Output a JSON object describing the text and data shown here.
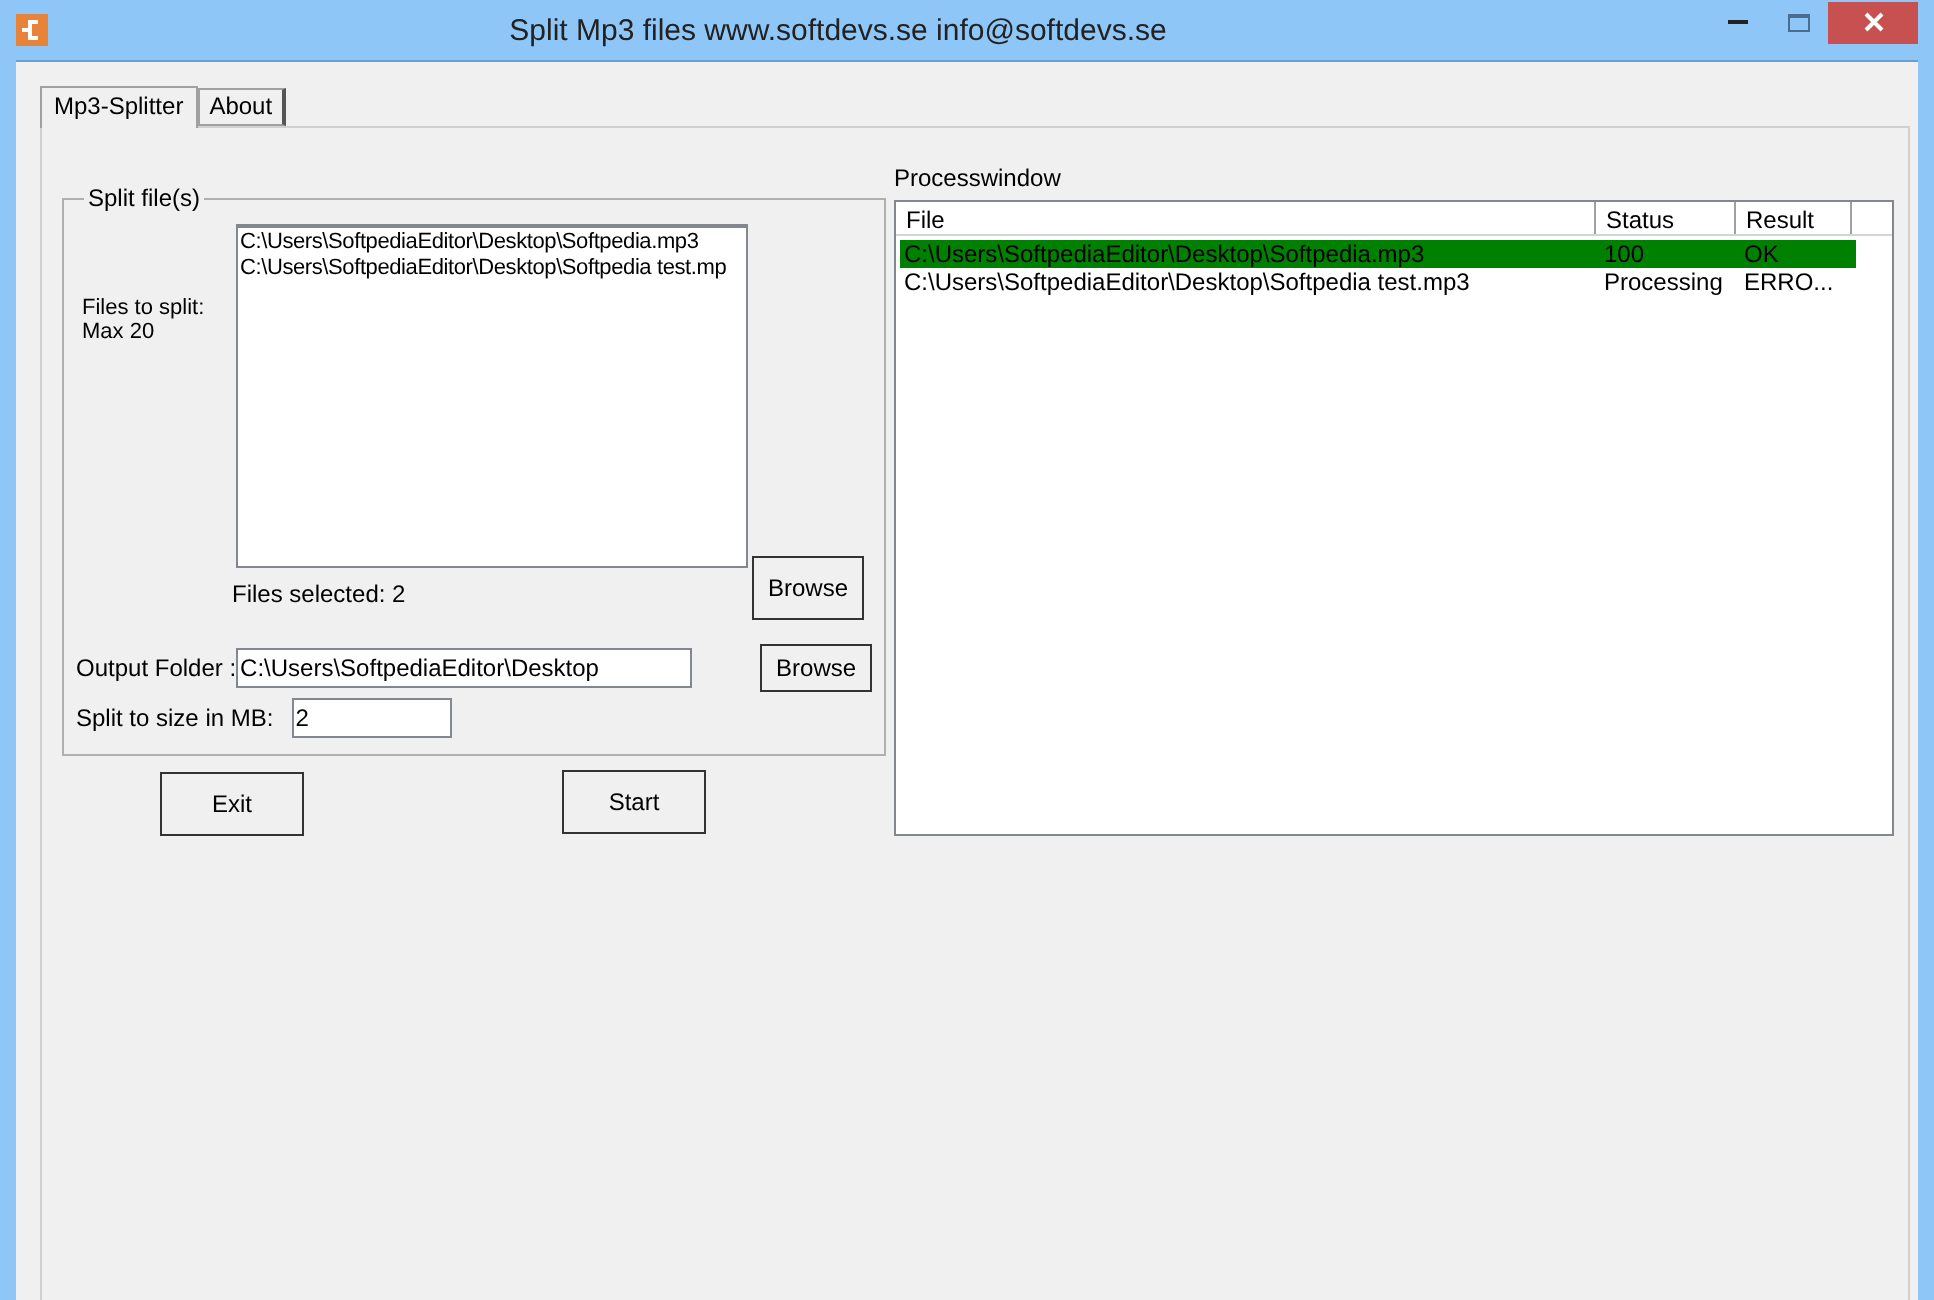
{
  "window": {
    "title": "Split Mp3 files www.softdevs.se info@softdevs.se"
  },
  "tabs": [
    {
      "label": "Mp3-Splitter",
      "selected": true
    },
    {
      "label": "About",
      "selected": false
    }
  ],
  "split_group": {
    "title": "Split file(s)",
    "files_label": "Files to split:",
    "files_hint": "Max 20",
    "files": [
      "C:\\Users\\SoftpediaEditor\\Desktop\\Softpedia.mp3",
      "C:\\Users\\SoftpediaEditor\\Desktop\\Softpedia test.mp"
    ],
    "files_selected": "Files selected: 2",
    "browse_files": "Browse",
    "output_label": "Output Folder :",
    "output_value": "C:\\Users\\SoftpediaEditor\\Desktop",
    "browse_output": "Browse",
    "size_label": "Split to size in MB:",
    "size_value": "2"
  },
  "buttons": {
    "exit": "Exit",
    "start": "Start"
  },
  "process": {
    "title": "Processwindow",
    "columns": [
      "File",
      "Status",
      "Result"
    ],
    "rows": [
      {
        "file": "C:\\Users\\SoftpediaEditor\\Desktop\\Softpedia.mp3",
        "status": "100",
        "result": "OK",
        "color": "#008000"
      },
      {
        "file": "C:\\Users\\SoftpediaEditor\\Desktop\\Softpedia test.mp3",
        "status": "Processing",
        "result": "ERRO...",
        "color": "#ffffff"
      }
    ]
  }
}
